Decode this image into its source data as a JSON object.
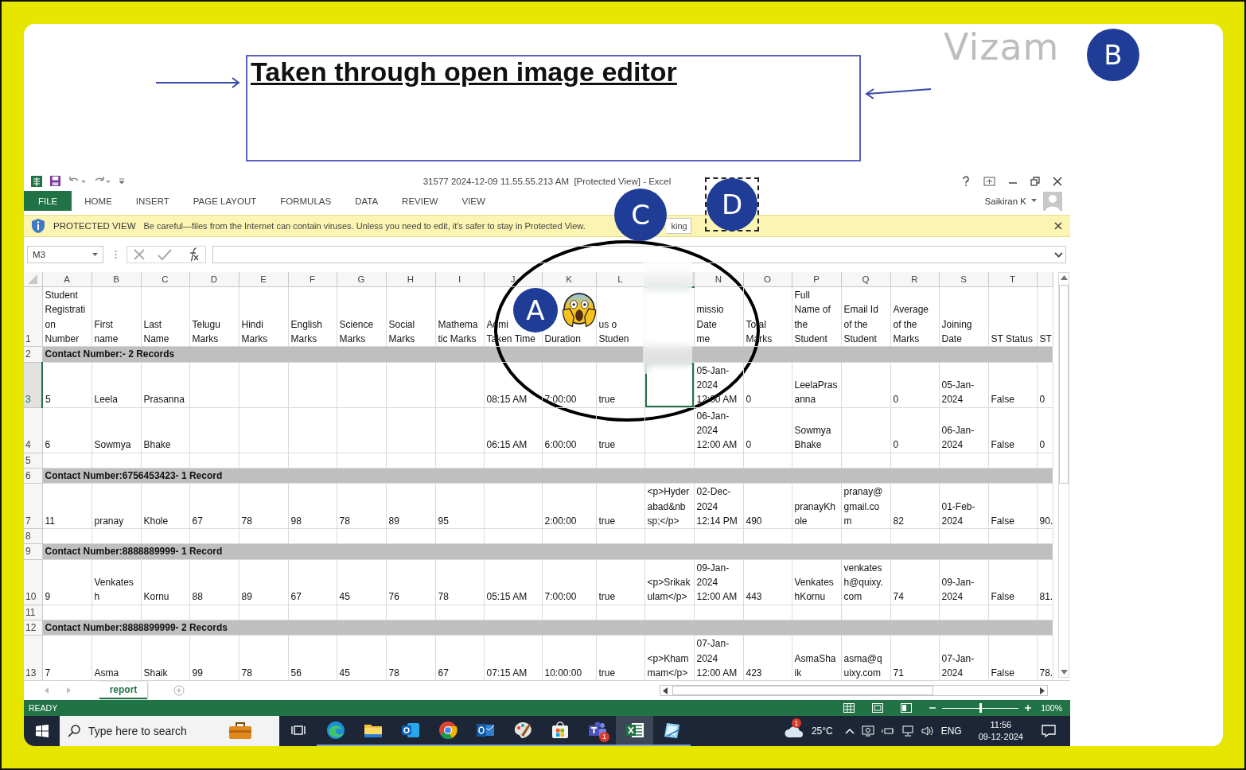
{
  "annotation": {
    "title": "Taken through open image editor",
    "watermark": "Vizam",
    "markers": [
      {
        "label": "A",
        "framed": false
      },
      {
        "label": "B",
        "framed": false
      },
      {
        "label": "C",
        "framed": false
      },
      {
        "label": "D",
        "framed": true
      }
    ]
  },
  "window": {
    "title": "31577 2024-12-09 11.55.55.213 AM  [Protected View] - Excel",
    "user": "Saikiran K"
  },
  "ribbon_tabs": [
    {
      "label": "FILE",
      "selected": true
    },
    {
      "label": "HOME",
      "selected": false
    },
    {
      "label": "INSERT",
      "selected": false
    },
    {
      "label": "PAGE LAYOUT",
      "selected": false
    },
    {
      "label": "FORMULAS",
      "selected": false
    },
    {
      "label": "DATA",
      "selected": false
    },
    {
      "label": "REVIEW",
      "selected": false
    },
    {
      "label": "VIEW",
      "selected": false
    }
  ],
  "protected_view": {
    "label": "PROTECTED VIEW",
    "message": "Be careful—files from the Internet can contain viruses. Unless you need to edit, it's safer to stay in Protected View.",
    "button": "king"
  },
  "formula_bar": {
    "name_box": "M3"
  },
  "sheet": {
    "columns": [
      {
        "letter": "A",
        "header": "Student\nRegistrati\non\nNumber",
        "selected": false
      },
      {
        "letter": "B",
        "header": "First\nname",
        "selected": false
      },
      {
        "letter": "C",
        "header": "Last\nName",
        "selected": false
      },
      {
        "letter": "D",
        "header": "Telugu\nMarks",
        "selected": false
      },
      {
        "letter": "E",
        "header": "Hindi\nMarks",
        "selected": false
      },
      {
        "letter": "F",
        "header": "English\nMarks",
        "selected": false
      },
      {
        "letter": "G",
        "header": "Science\nMarks",
        "selected": false
      },
      {
        "letter": "H",
        "header": "Social\nMarks",
        "selected": false
      },
      {
        "letter": "I",
        "header": "Mathema\ntic Marks",
        "selected": false
      },
      {
        "letter": "J",
        "header": "Admi\nTaken Time",
        "selected": false
      },
      {
        "letter": "K",
        "header": "Duration",
        "selected": false
      },
      {
        "letter": "L",
        "header": "us o\nStuden",
        "selected": false
      },
      {
        "selected": true
      },
      {
        "letter": "N",
        "header": "missio\nDate\nme",
        "selected": false
      },
      {
        "letter": "O",
        "header": "Total\nMarks",
        "selected": false
      },
      {
        "letter": "P",
        "header": "Full\nName of\nthe\nStudent",
        "selected": false
      },
      {
        "letter": "Q",
        "header": "Email Id\nof the\nStudent",
        "selected": false
      },
      {
        "letter": "R",
        "header": "Average\nof the\nMarks",
        "selected": false
      },
      {
        "letter": "S",
        "header": "Joining\nDate",
        "selected": false
      },
      {
        "letter": "T",
        "header": "ST Status",
        "selected": false
      },
      {
        "header": "ST",
        "selected": false
      }
    ],
    "rows": [
      {
        "number": "1",
        "kind": "header",
        "selected": false
      },
      {
        "number": "2",
        "kind": "group",
        "text": "Contact Number:- 2 Records",
        "selected": false
      },
      {
        "number": "3",
        "kind": "data",
        "selected": true,
        "cells": {
          "A": "5",
          "B": "Leela",
          "C": "Prasanna",
          "J": "08:15 AM",
          "K": "7:00:00",
          "L": "true",
          "N": "05-Jan-\n2024\n12:00 AM",
          "O": "0",
          "P": "LeelaPras\nanna",
          "R": "0",
          "S": "05-Jan-\n2024",
          "T": "False",
          "U": "0"
        }
      },
      {
        "number": "4",
        "kind": "data",
        "selected": false,
        "cells": {
          "A": "6",
          "B": "Sowmya",
          "C": "Bhake",
          "J": "06:15 AM",
          "K": "6:00:00",
          "L": "true",
          "N": "06-Jan-\n2024\n12:00 AM",
          "O": "0",
          "P": "Sowmya\nBhake",
          "R": "0",
          "S": "06-Jan-\n2024",
          "T": "False",
          "U": "0"
        }
      },
      {
        "number": "5",
        "kind": "blank",
        "selected": false
      },
      {
        "number": "6",
        "kind": "group",
        "text": "Contact Number:6756453423- 1 Record",
        "selected": false
      },
      {
        "number": "7",
        "kind": "data",
        "selected": false,
        "cells": {
          "A": "11",
          "B": "pranay",
          "C": "Khole",
          "D": "67",
          "E": "78",
          "F": "98",
          "G": "78",
          "H": "89",
          "I": "95",
          "K": "2:00:00",
          "L": "true",
          "M": "<p>Hyder\nabad&nb\nsp;</p>",
          "N": "02-Dec-\n2024\n12:14 PM",
          "O": "490",
          "P": "pranayKh\nole",
          "Q": "pranay@\ngmail.co\nm",
          "R": "82",
          "S": "01-Feb-\n2024",
          "T": "False",
          "U": "90."
        }
      },
      {
        "number": "8",
        "kind": "blank",
        "selected": false
      },
      {
        "number": "9",
        "kind": "group",
        "text": "Contact Number:8888889999- 1 Record",
        "selected": false
      },
      {
        "number": "10",
        "kind": "data",
        "selected": false,
        "cells": {
          "A": "9",
          "B": "Venkates\nh",
          "C": "Kornu",
          "D": "88",
          "E": "89",
          "F": "67",
          "G": "45",
          "H": "76",
          "I": "78",
          "J": "05:15 AM",
          "K": "7:00:00",
          "L": "true",
          "M": "<p>Srikak\nulam</p>",
          "N": "09-Jan-\n2024\n12:00 AM",
          "O": "443",
          "P": "Venkates\nhKornu",
          "Q": "venkates\nh@quixy.\ncom",
          "R": "74",
          "S": "09-Jan-\n2024",
          "T": "False",
          "U": "81."
        }
      },
      {
        "number": "11",
        "kind": "blank",
        "selected": false
      },
      {
        "number": "12",
        "kind": "group",
        "text": "Contact Number:8888899999- 2 Records",
        "selected": false
      },
      {
        "number": "13",
        "kind": "data",
        "selected": false,
        "cells": {
          "A": "7",
          "B": "Asma",
          "C": "Shaik",
          "D": "99",
          "E": "78",
          "F": "56",
          "G": "45",
          "H": "78",
          "I": "67",
          "J": "07:15 AM",
          "K": "10:00:00",
          "L": "true",
          "M": "<p>Kham\nmam</p>",
          "N": "07-Jan-\n2024\n12:00 AM",
          "O": "423",
          "P": "AsmaSha\nik",
          "Q": "asma@q\nuixy.com",
          "R": "71",
          "S": "07-Jan-\n2024",
          "T": "False",
          "U": "78."
        }
      }
    ]
  },
  "sheet_tabs": [
    {
      "label": "report",
      "selected": true
    }
  ],
  "status_bar": {
    "text": "READY",
    "zoom": "100%",
    "zoom_slider": {
      "level": 0.5
    }
  },
  "taskbar": {
    "search": {
      "placeholder": "Type here to search"
    },
    "apps": [
      {
        "kind": "task-view",
        "selected": false
      },
      {
        "kind": "edge",
        "selected": false
      },
      {
        "kind": "folder",
        "selected": false
      },
      {
        "kind": "mail-new",
        "selected": false
      },
      {
        "kind": "chrome",
        "selected": false
      },
      {
        "kind": "mail",
        "selected": false
      },
      {
        "kind": "paint",
        "selected": false
      },
      {
        "kind": "store",
        "selected": false
      },
      {
        "kind": "teams",
        "selected": false,
        "badge": "1"
      },
      {
        "kind": "excel",
        "selected": true
      },
      {
        "kind": "notes",
        "selected": false
      }
    ],
    "weather": {
      "temperature": "25°C",
      "badge": "1"
    },
    "language": "ENG",
    "time": "11:56",
    "date": "09-12-2024"
  }
}
